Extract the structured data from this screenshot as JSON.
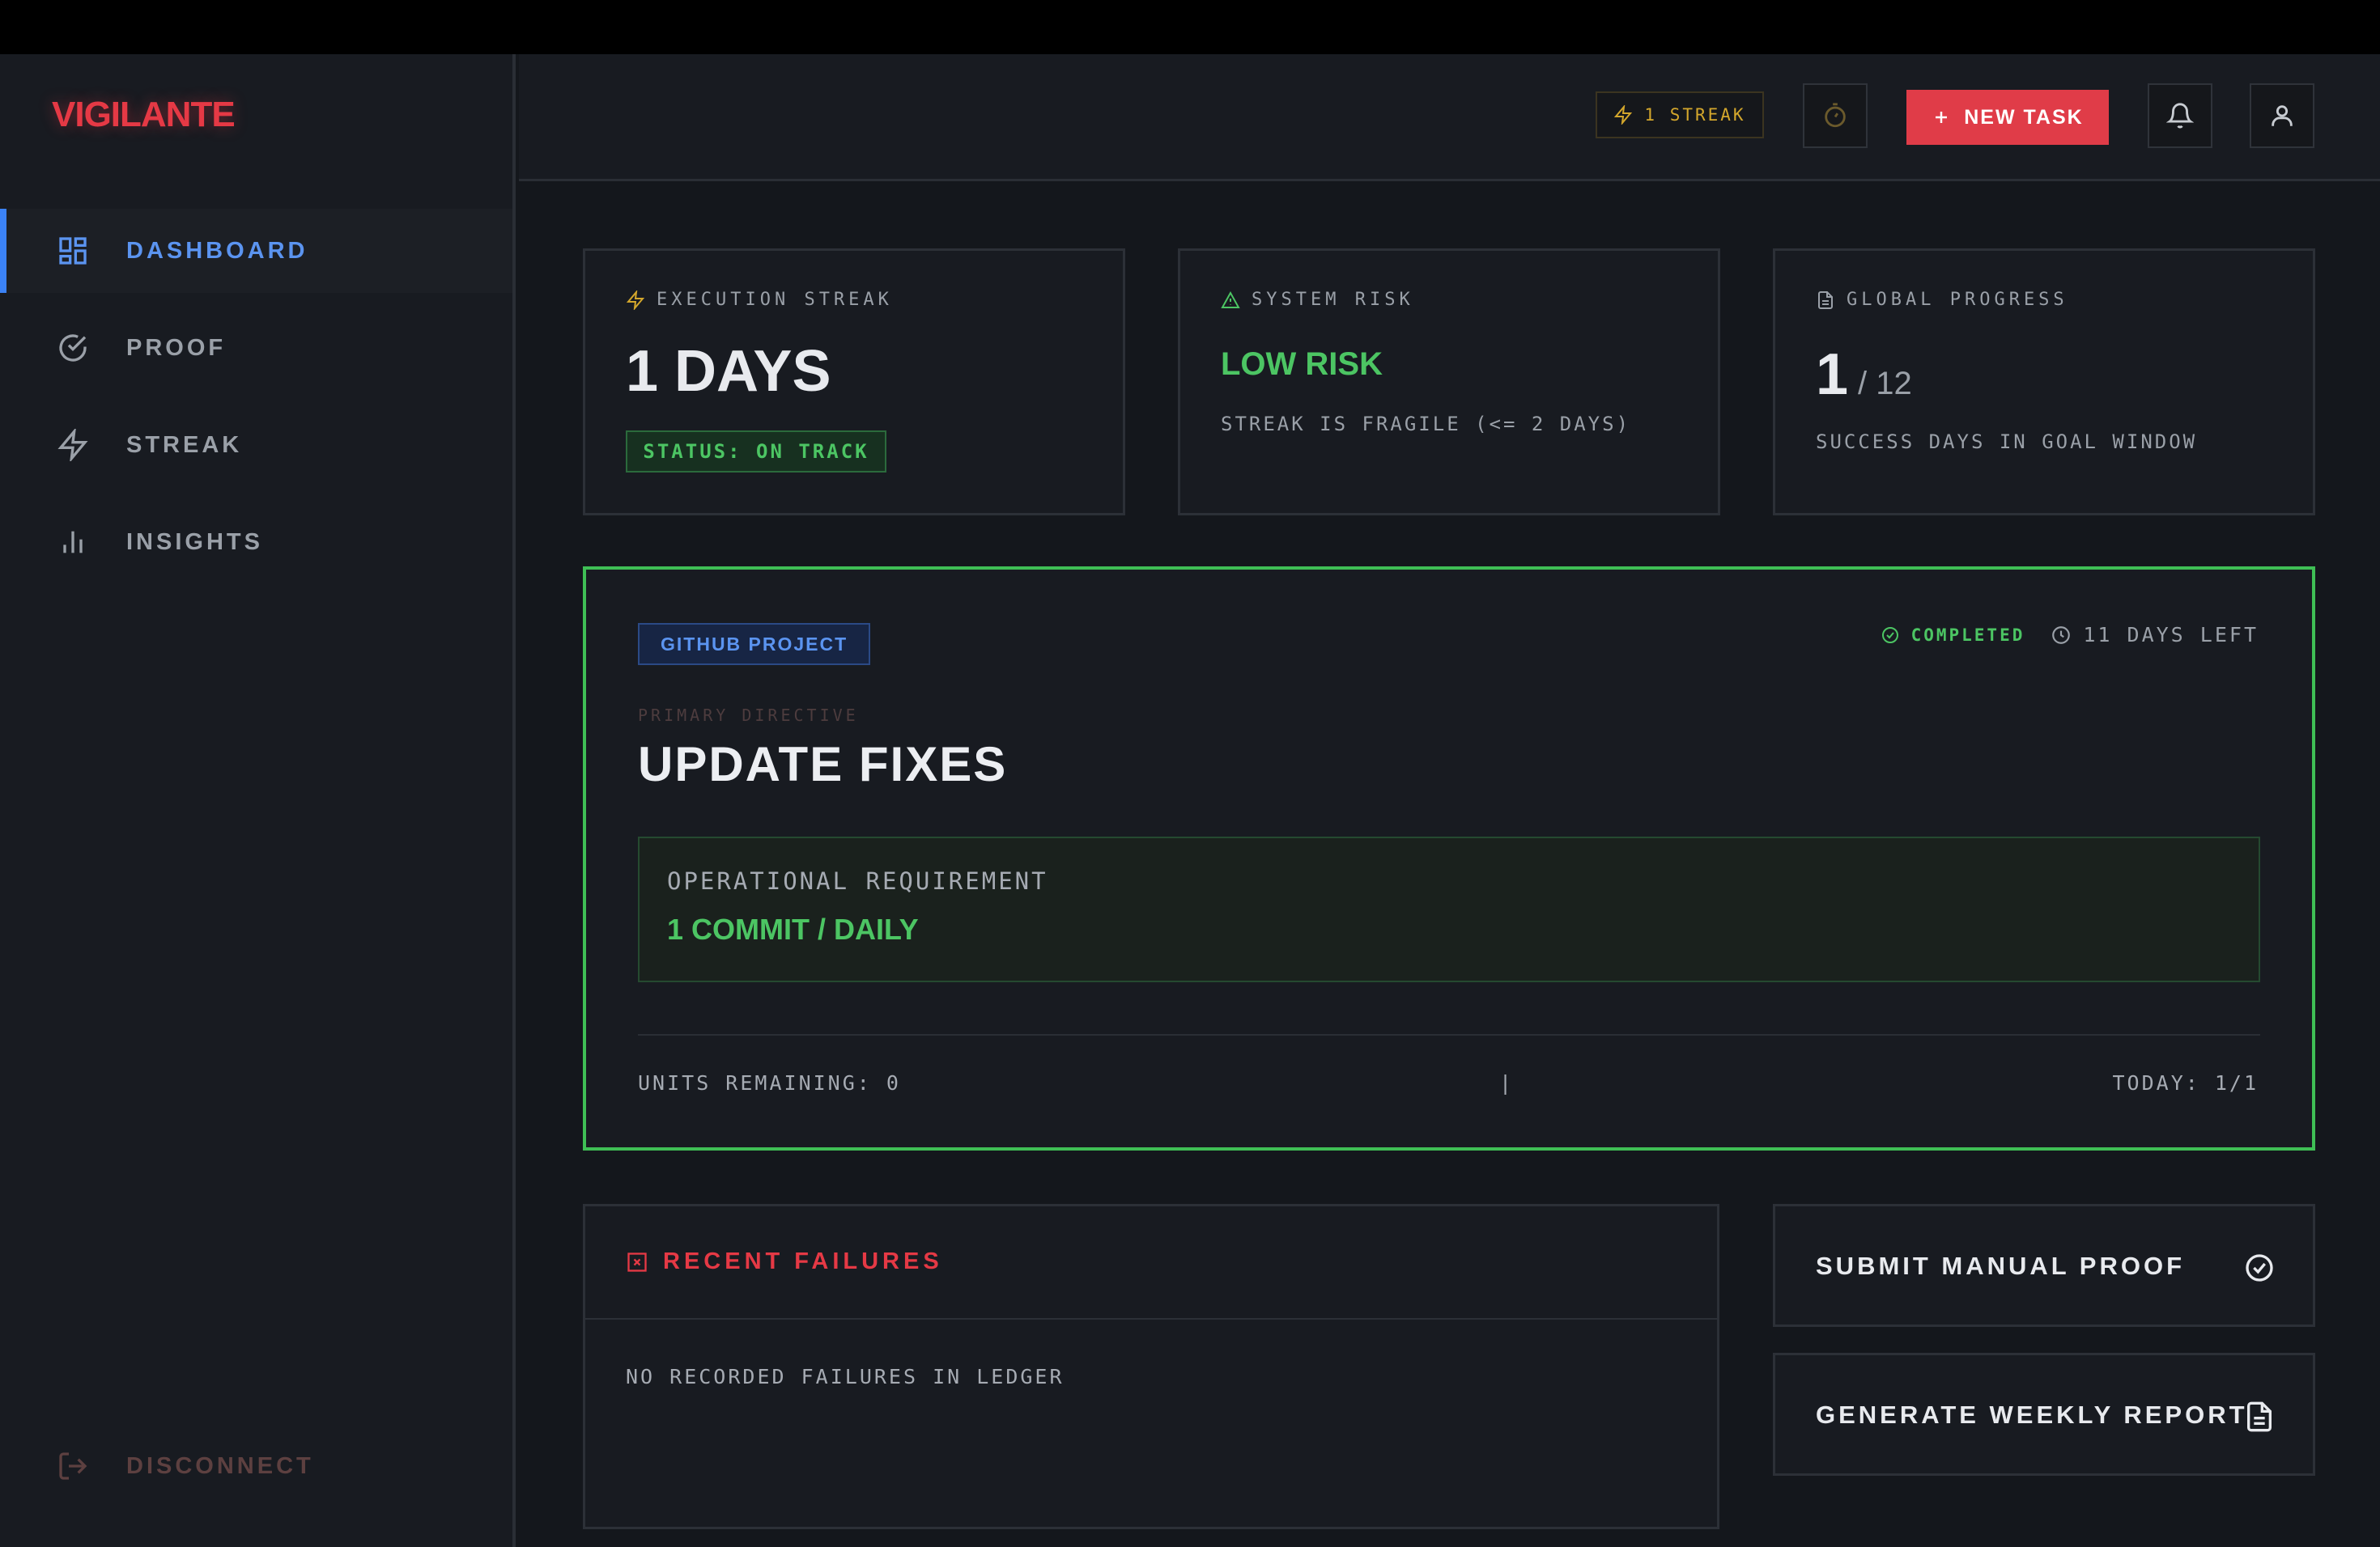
{
  "app": {
    "name": "VIGILANTE"
  },
  "sidebar": {
    "items": [
      {
        "label": "DASHBOARD",
        "icon": "dashboard-icon",
        "active": true
      },
      {
        "label": "PROOF",
        "icon": "check-circle-icon"
      },
      {
        "label": "STREAK",
        "icon": "lightning-icon"
      },
      {
        "label": "INSIGHTS",
        "icon": "bar-chart-icon"
      }
    ],
    "logout": {
      "label": "DISCONNECT",
      "icon": "logout-icon"
    }
  },
  "header": {
    "streak_label": "1 STREAK",
    "new_task_label": "NEW TASK"
  },
  "stats": {
    "streak": {
      "label": "EXECUTION STREAK",
      "value": "1 DAYS",
      "status": "STATUS: ON TRACK"
    },
    "risk": {
      "label": "SYSTEM RISK",
      "value": "LOW RISK",
      "note": "STREAK IS FRAGILE (<= 2 DAYS)"
    },
    "progress": {
      "label": "GLOBAL PROGRESS",
      "value": "1",
      "total": "/ 12",
      "note": "SUCCESS DAYS IN GOAL WINDOW"
    }
  },
  "project": {
    "tag": "GITHUB PROJECT",
    "status": "COMPLETED",
    "days_left": "11 DAYS LEFT",
    "directive_label": "PRIMARY DIRECTIVE",
    "title": "UPDATE FIXES",
    "requirement_label": "OPERATIONAL REQUIREMENT",
    "requirement_value": "1 COMMIT / DAILY",
    "units_remaining": "UNITS REMAINING: 0",
    "separator": "|",
    "today": "TODAY: 1/1"
  },
  "failures": {
    "title": "RECENT FAILURES",
    "empty": "NO RECORDED FAILURES IN LEDGER"
  },
  "actions": {
    "submit_proof": "SUBMIT MANUAL PROOF",
    "weekly_report": "GENERATE WEEKLY REPORT"
  },
  "colors": {
    "accent_red": "#e53945",
    "accent_blue": "#5b94f0",
    "success_green": "#4cc563",
    "warning_amber": "#d4a72c"
  }
}
